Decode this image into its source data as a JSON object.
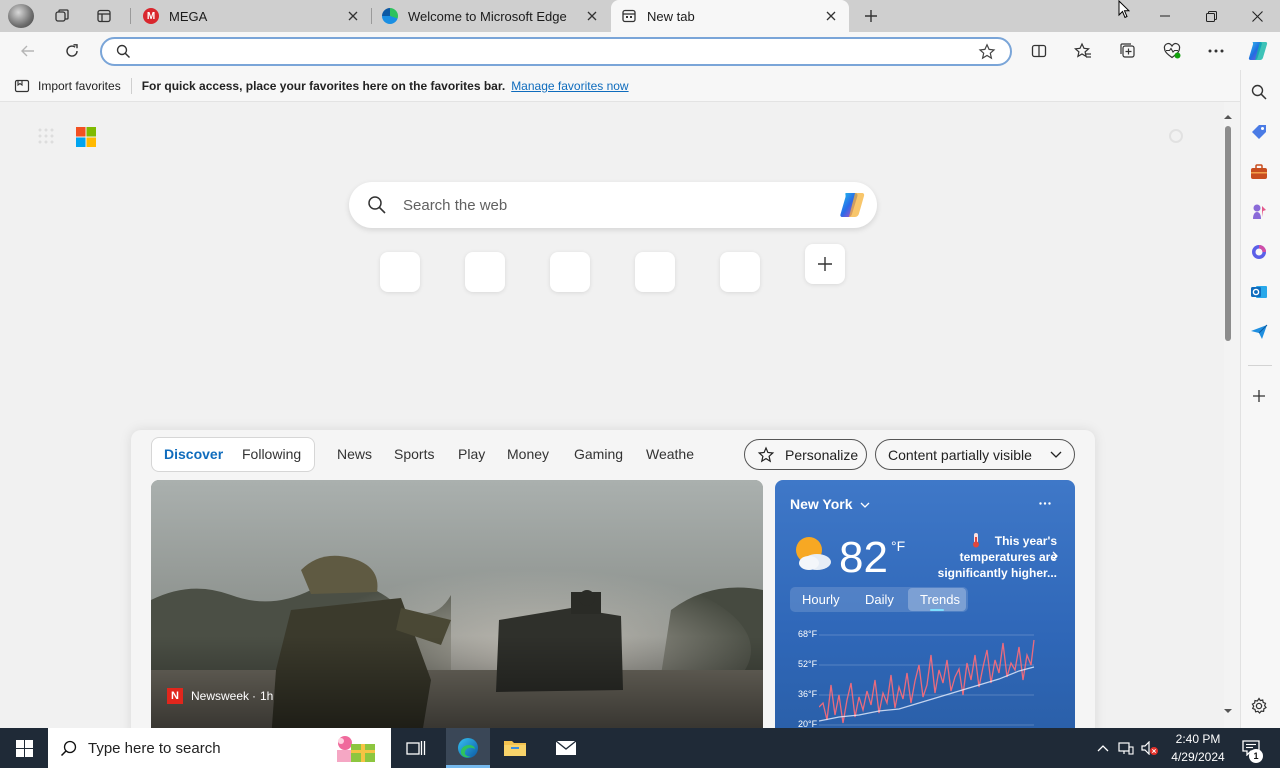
{
  "tabs": [
    {
      "title": "MEGA",
      "active": false
    },
    {
      "title": "Welcome to Microsoft Edge",
      "active": false
    },
    {
      "title": "New tab",
      "active": true
    }
  ],
  "address": {
    "value": "",
    "placeholder": ""
  },
  "favorites_bar": {
    "import_label": "Import favorites",
    "message": "For quick access, place your favorites here on the favorites bar.",
    "manage_link": "Manage favorites now"
  },
  "ntp": {
    "search_placeholder": "Search the web"
  },
  "feed": {
    "tabs": [
      "Discover",
      "Following"
    ],
    "nav": [
      "News",
      "Sports",
      "Play",
      "Money",
      "Gaming",
      "Weathe"
    ],
    "personalize": "Personalize",
    "content_visibility": "Content partially visible",
    "hero": {
      "source": "Newsweek",
      "time": "1h"
    }
  },
  "weather": {
    "location": "New York",
    "temp": "82",
    "unit": "°F",
    "alert": "This year's temperatures are significantly higher...",
    "tabs": [
      "Hourly",
      "Daily",
      "Trends"
    ],
    "active_tab": "Trends",
    "chart_labels": [
      "68°F",
      "52°F",
      "36°F",
      "20°F"
    ]
  },
  "taskbar": {
    "search_placeholder": "Type here to search",
    "time": "2:40 PM",
    "date": "4/29/2024",
    "notification_count": "1"
  },
  "colors": {
    "accent": "#0f6cbd",
    "mega": "#d9272e",
    "taskbar": "#1f2a37"
  }
}
